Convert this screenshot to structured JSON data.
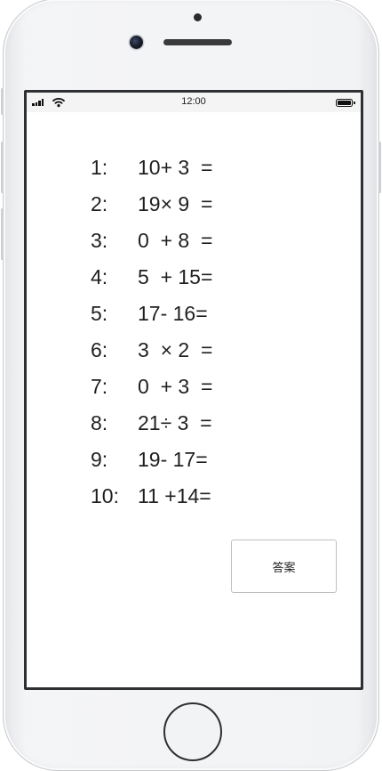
{
  "status_bar": {
    "time": "12:00"
  },
  "questions": [
    {
      "number": "1:",
      "expression": "10+ 3  ="
    },
    {
      "number": "2:",
      "expression": "19× 9  ="
    },
    {
      "number": "3:",
      "expression": "0  + 8  ="
    },
    {
      "number": "4:",
      "expression": "5  + 15="
    },
    {
      "number": "5:",
      "expression": "17- 16="
    },
    {
      "number": "6:",
      "expression": "3  × 2  ="
    },
    {
      "number": "7:",
      "expression": "0  + 3  ="
    },
    {
      "number": "8:",
      "expression": "21÷ 3  ="
    },
    {
      "number": "9:",
      "expression": "19- 17="
    },
    {
      "number": "10:",
      "expression": "11 +14="
    }
  ],
  "answer_button": {
    "label": "答案"
  },
  "icons": {
    "signal": "cellular-signal-icon",
    "wifi": "wifi-icon",
    "battery": "battery-icon"
  }
}
